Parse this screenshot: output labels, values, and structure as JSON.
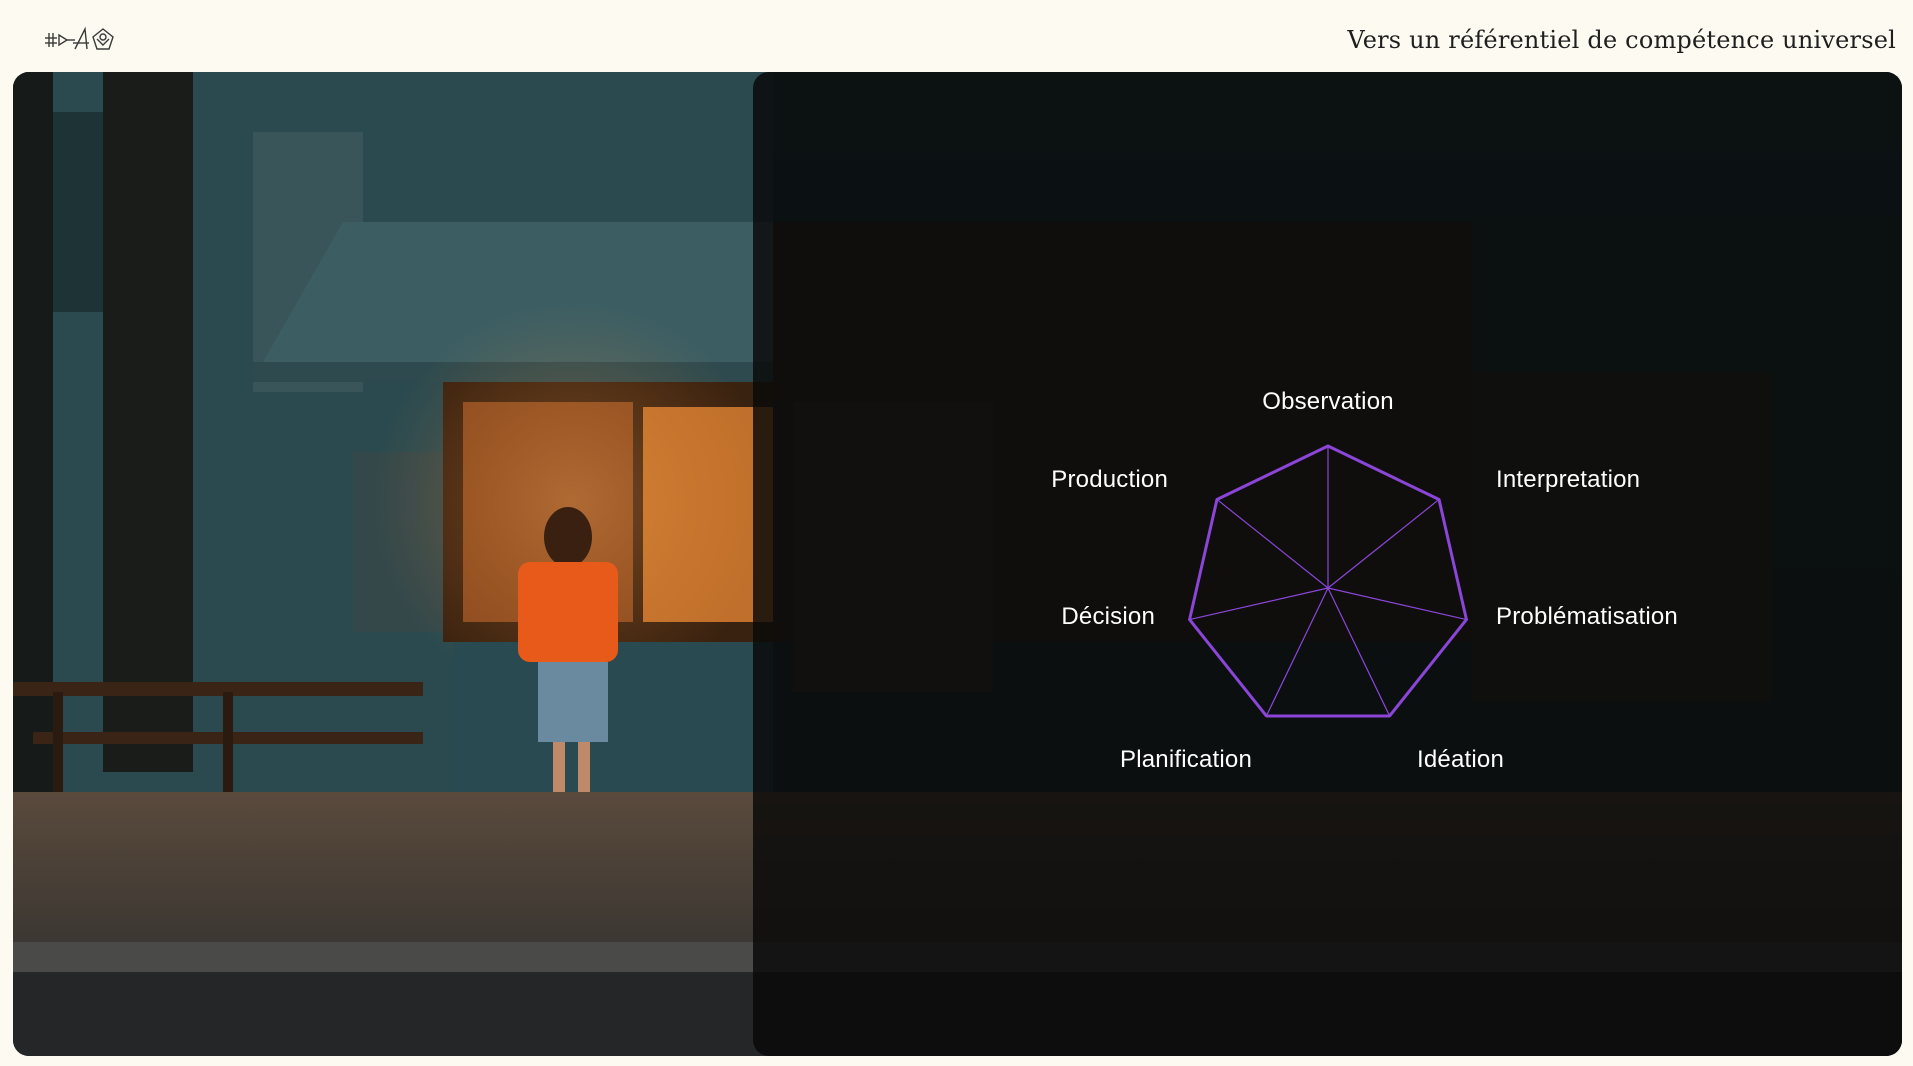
{
  "header": {
    "logo_text": "⊹▷A◈",
    "headline": "Vers un référentiel de compétence universel"
  },
  "chart_data": {
    "type": "radar",
    "axes": [
      "Observation",
      "Interpretation",
      "Problématisation",
      "Idéation",
      "Planification",
      "Décision",
      "Production"
    ],
    "accent_color": "#8b46d8"
  }
}
